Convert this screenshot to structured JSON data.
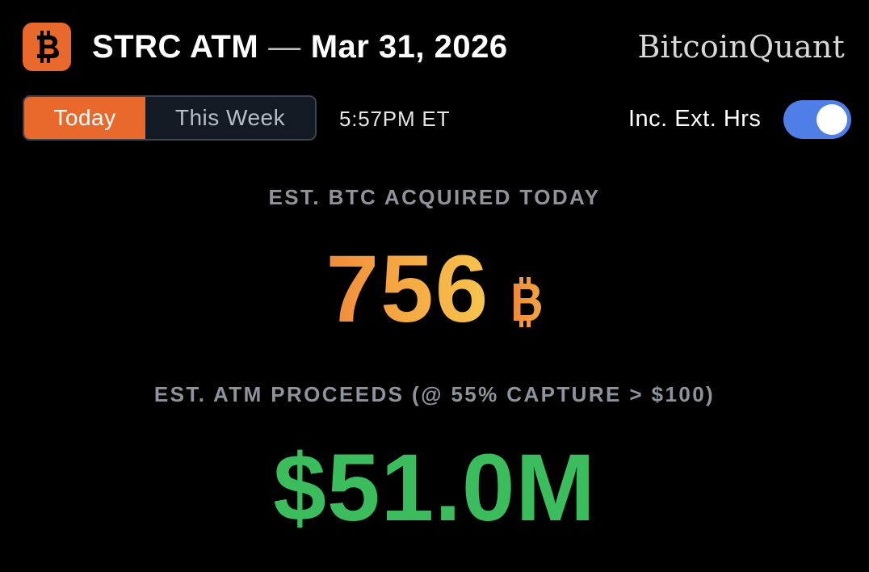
{
  "header": {
    "logo_icon": "bitcoin-icon",
    "title": "STRC ATM",
    "title_dash": "—",
    "date": "Mar 31, 2026",
    "brand": "BitcoinQuant"
  },
  "controls": {
    "tabs": [
      {
        "label": "Today",
        "selected": true
      },
      {
        "label": "This Week",
        "selected": false
      }
    ],
    "time": "5:57PM ET",
    "ext_hours_label": "Inc. Ext. Hrs",
    "ext_hours_on": true
  },
  "metrics": {
    "btc_label": "EST. BTC ACQUIRED TODAY",
    "btc_value": "756",
    "btc_unit_icon": "bitcoin-symbol-icon",
    "proceeds_label": "EST. ATM PROCEEDS (@ 55% CAPTURE > $100)",
    "proceeds_value": "$51.0M"
  },
  "colors": {
    "accent_orange": "#e8692b",
    "toggle_blue": "#4f7fe6",
    "btc_gradient_start": "#f08a3a",
    "btc_gradient_end": "#f6c54d",
    "proceeds_green": "#3bbd5e",
    "label_gray": "#8f949c",
    "background": "#000000"
  }
}
